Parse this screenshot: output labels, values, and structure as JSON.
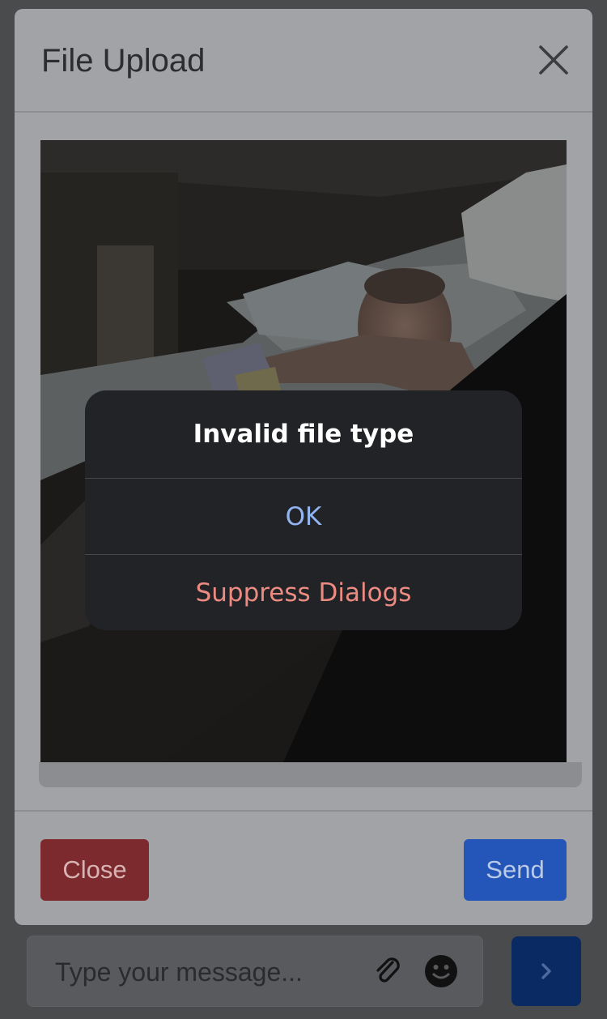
{
  "modal": {
    "title": "File Upload",
    "close_button_label": "Close",
    "send_button_label": "Send"
  },
  "alert": {
    "title": "Invalid file type",
    "ok_label": "OK",
    "suppress_label": "Suppress Dialogs"
  },
  "composer": {
    "placeholder": "Type your message..."
  },
  "colors": {
    "close_button": "#7d2a2e",
    "send_button": "#2455b8",
    "alert_ok": "#92b5f2",
    "alert_suppress": "#ec8b82"
  },
  "icons": {
    "close": "close-icon",
    "attach": "paperclip-icon",
    "emoji": "emoji-icon",
    "send": "chevron-right-icon"
  }
}
